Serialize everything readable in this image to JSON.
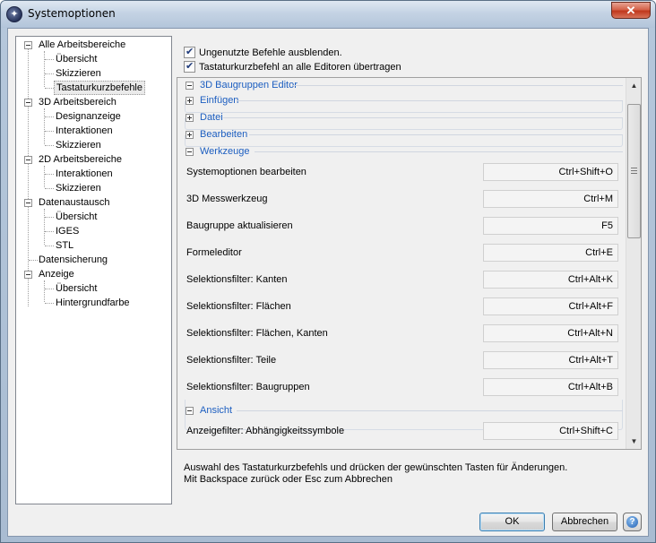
{
  "window": {
    "title": "Systemoptionen",
    "close_glyph": "✕",
    "icon": "app-logo-icon"
  },
  "tree": [
    {
      "label": "Alle Arbeitsbereiche",
      "level": 0,
      "expanded": true
    },
    {
      "label": "Übersicht",
      "level": 1
    },
    {
      "label": "Skizzieren",
      "level": 1
    },
    {
      "label": "Tastaturkurzbefehle",
      "level": 1,
      "selected": true
    },
    {
      "label": "3D Arbeitsbereich",
      "level": 0,
      "expanded": true
    },
    {
      "label": "Designanzeige",
      "level": 1
    },
    {
      "label": "Interaktionen",
      "level": 1
    },
    {
      "label": "Skizzieren",
      "level": 1
    },
    {
      "label": "2D Arbeitsbereiche",
      "level": 0,
      "expanded": true
    },
    {
      "label": "Interaktionen",
      "level": 1
    },
    {
      "label": "Skizzieren",
      "level": 1
    },
    {
      "label": "Datenaustausch",
      "level": 0,
      "expanded": true
    },
    {
      "label": "Übersicht",
      "level": 1
    },
    {
      "label": "IGES",
      "level": 1
    },
    {
      "label": "STL",
      "level": 1
    },
    {
      "label": "Datensicherung",
      "level": 0,
      "leaf": true
    },
    {
      "label": "Anzeige",
      "level": 0,
      "expanded": true
    },
    {
      "label": "Übersicht",
      "level": 1
    },
    {
      "label": "Hintergrundfarbe",
      "level": 1
    }
  ],
  "options": {
    "hide_unused": {
      "label": "Ungenutzte Befehle ausblenden.",
      "checked": true
    },
    "transfer_all": {
      "label": "Tastaturkurzbefehl an alle Editoren übertragen",
      "checked": true
    }
  },
  "groups": {
    "root": "3D Baugruppen Editor",
    "einfuegen": "Einfügen",
    "datei": "Datei",
    "bearbeiten": "Bearbeiten",
    "werkzeuge": "Werkzeuge",
    "ansicht": "Ansicht"
  },
  "commands": [
    {
      "label": "Systemoptionen bearbeiten",
      "key": "Ctrl+Shift+O"
    },
    {
      "label": "3D Messwerkzeug",
      "key": "Ctrl+M"
    },
    {
      "label": "Baugruppe aktualisieren",
      "key": "F5"
    },
    {
      "label": "Formeleditor",
      "key": "Ctrl+E"
    },
    {
      "label": "Selektionsfilter: Kanten",
      "key": "Ctrl+Alt+K"
    },
    {
      "label": "Selektionsfilter: Flächen",
      "key": "Ctrl+Alt+F"
    },
    {
      "label": "Selektionsfilter: Flächen, Kanten",
      "key": "Ctrl+Alt+N"
    },
    {
      "label": "Selektionsfilter: Teile",
      "key": "Ctrl+Alt+T"
    },
    {
      "label": "Selektionsfilter: Baugruppen",
      "key": "Ctrl+Alt+B"
    }
  ],
  "ansicht_commands": [
    {
      "label": "Anzeigefilter: Abhängigkeitssymbole",
      "key": "Ctrl+Shift+C"
    }
  ],
  "help": {
    "line1": "Auswahl des Tastaturkurzbefehls und drücken der gewünschten Tasten für Änderungen.",
    "line2": "Mit Backspace zurück oder Esc zum Abbrechen"
  },
  "buttons": {
    "ok": "OK",
    "cancel": "Abbrechen",
    "help": "?"
  }
}
